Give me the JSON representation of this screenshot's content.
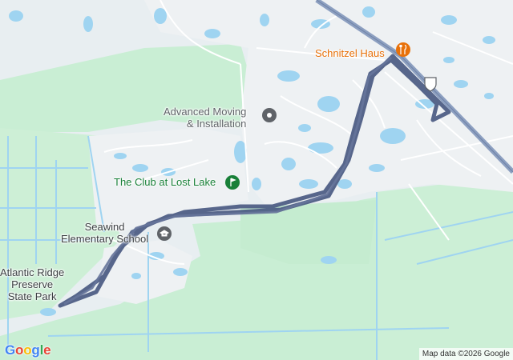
{
  "map": {
    "pois": [
      {
        "id": "schnitzel",
        "label": "Schnitzel Haus",
        "icon": "restaurant-icon",
        "color": "#e8710a"
      },
      {
        "id": "moving",
        "label": "Advanced Moving\n& Installation",
        "icon": "place-pin-icon",
        "color": "#5f6368"
      },
      {
        "id": "club",
        "label": "The Club at Lost Lake",
        "icon": "golf-icon",
        "color": "#188038"
      },
      {
        "id": "school",
        "label": "Seawind\nElementary School",
        "icon": "school-icon",
        "color": "#3c4043"
      },
      {
        "id": "park",
        "label": "Atlantic Ridge\nPreserve\nState Park",
        "icon": "park-label",
        "color": "#3c4043"
      }
    ],
    "highway_shield": "US highway shield",
    "route_color": "#4a5a82",
    "colors": {
      "land": "#e8eef1",
      "green": "#c9eed4",
      "water": "#9fd4f1",
      "road": "#ffffff",
      "highway": "#8c9fc0"
    },
    "attribution": "Map data ©2026 Google",
    "logo": "Google"
  }
}
